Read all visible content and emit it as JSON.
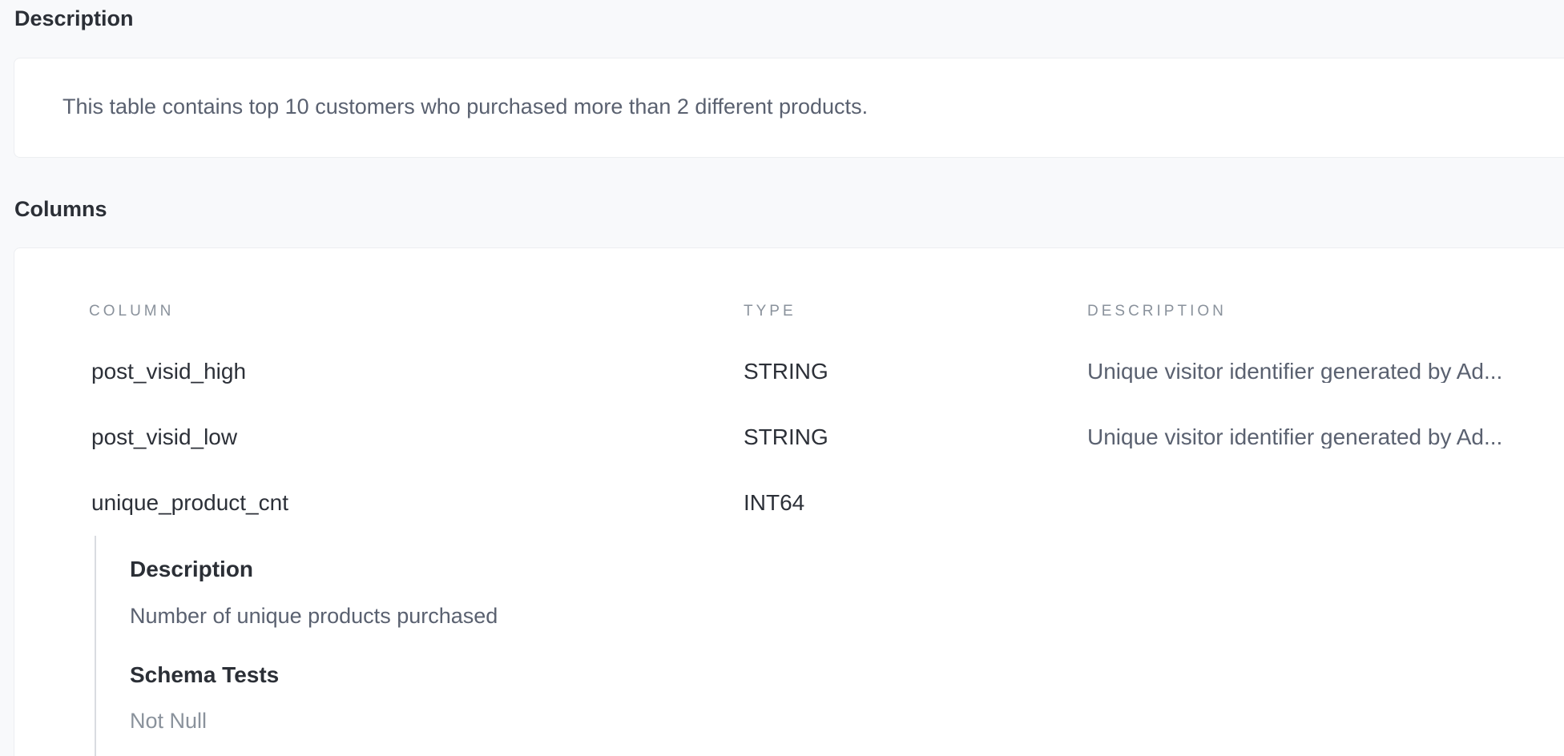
{
  "description_section": {
    "heading": "Description",
    "text": "This table contains top 10 customers who purchased more than 2 different products."
  },
  "columns_section": {
    "heading": "Columns",
    "headers": {
      "column": "COLUMN",
      "type": "TYPE",
      "description": "DESCRIPTION"
    },
    "rows": [
      {
        "name": "post_visid_high",
        "type": "STRING",
        "description": "Unique visitor identifier generated by Ad..."
      },
      {
        "name": "post_visid_low",
        "type": "STRING",
        "description": "Unique visitor identifier generated by Ad..."
      },
      {
        "name": "unique_product_cnt",
        "type": "INT64",
        "description": ""
      }
    ],
    "expanded_detail": {
      "description_heading": "Description",
      "description_text": "Number of unique products purchased",
      "schema_tests_heading": "Schema Tests",
      "schema_tests_text": "Not Null"
    }
  }
}
